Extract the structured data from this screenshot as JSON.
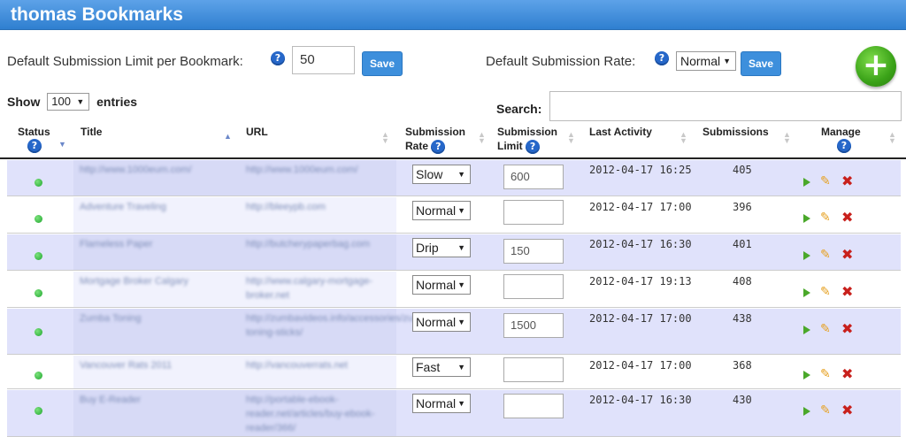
{
  "page": {
    "title": "thomas Bookmarks",
    "colors": {
      "header": "#3f8ee0",
      "odd_row": "#e0e2fb",
      "accent": "#3d8fdc",
      "add": "#3aa218"
    }
  },
  "settings": {
    "limit_label": "Default Submission Limit per Bookmark:",
    "limit_value": "50",
    "save_label": "Save",
    "rate_label": "Default Submission Rate:",
    "rate_value": "Normal",
    "help_icon": "?",
    "add_icon": "+"
  },
  "table_controls": {
    "show_label": "Show",
    "entries_value": "100",
    "entries_label": "entries",
    "search_label": "Search:"
  },
  "columns": {
    "status": "Status",
    "title": "Title",
    "url": "URL",
    "rate_line1": "Submission",
    "rate_line2": "Rate",
    "limit_line1": "Submission",
    "limit_line2": "Limit",
    "activity": "Last Activity",
    "submissions": "Submissions",
    "manage": "Manage"
  },
  "rows": [
    {
      "title": "http://www.1000eum.com/",
      "url": "http://www.1000eum.com/",
      "rate": "Slow",
      "limit": "600",
      "activity": "2012-04-17 16:25",
      "submissions": "405"
    },
    {
      "title": "Adventure Traveling",
      "url": "http://bleeypb.com",
      "rate": "Normal",
      "limit": "",
      "activity": "2012-04-17 17:00",
      "submissions": "396"
    },
    {
      "title": "Flameless Paper",
      "url": "http://butcherypaperbag.com",
      "rate": "Drip",
      "limit": "150",
      "activity": "2012-04-17 16:30",
      "submissions": "401"
    },
    {
      "title": "Mortgage Broker Calgary",
      "url": "http://www.calgary-mortgage-broker.net",
      "rate": "Normal",
      "limit": "",
      "activity": "2012-04-17 19:13",
      "submissions": "408"
    },
    {
      "title": "Zumba Toning",
      "url": "http://zumbavideos.info/accessories/zumba-toning-sticks/",
      "rate": "Normal",
      "limit": "1500",
      "activity": "2012-04-17 17:00",
      "submissions": "438"
    },
    {
      "title": "Vancouver Rats 2011",
      "url": "http://vancouverrats.net",
      "rate": "Fast",
      "limit": "",
      "activity": "2012-04-17 17:00",
      "submissions": "368"
    },
    {
      "title": "Buy E-Reader",
      "url": "http://portable-ebook-reader.net/articles/buy-ebook-reader/366/",
      "rate": "Normal",
      "limit": "",
      "activity": "2012-04-17 16:30",
      "submissions": "430"
    }
  ]
}
